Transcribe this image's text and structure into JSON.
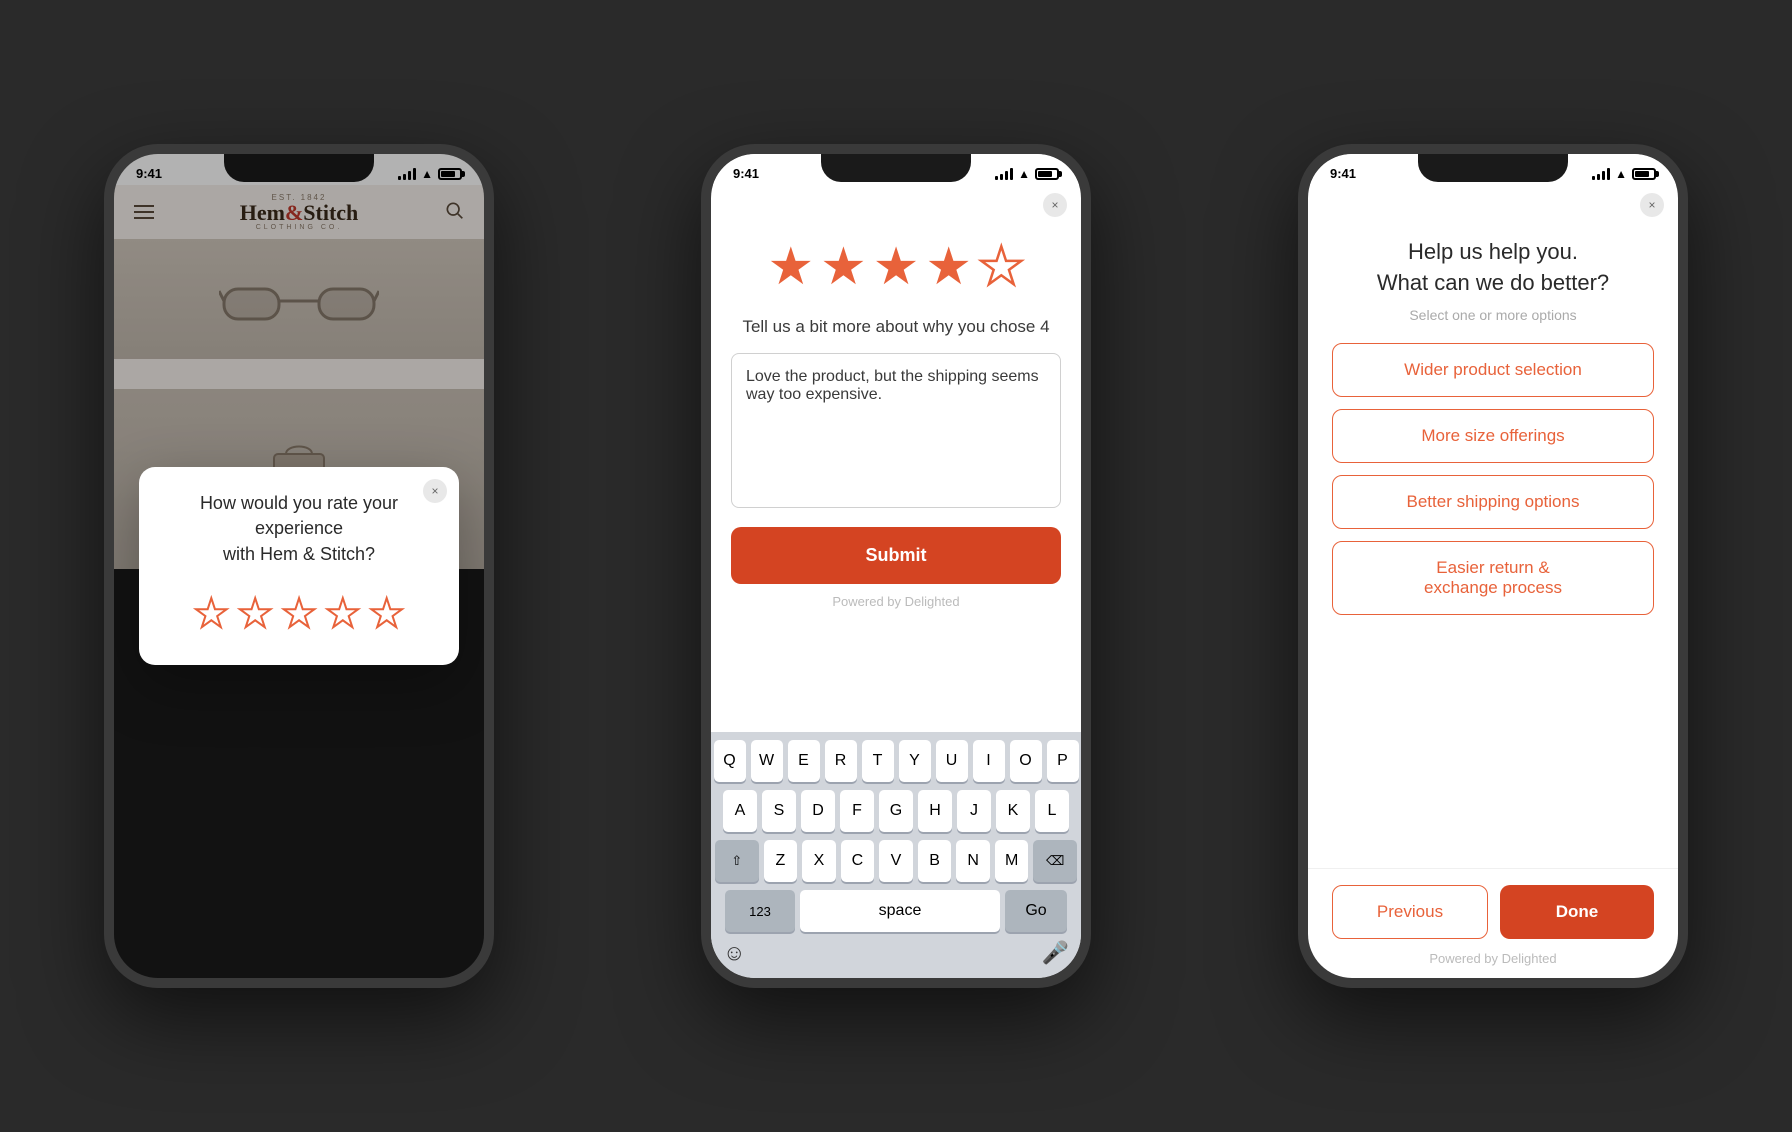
{
  "colors": {
    "accent": "#e8623a",
    "accent_dark": "#d44422",
    "bg_app": "#f5f0eb",
    "text_dark": "#2a2a2a",
    "text_muted": "#aaaaaa",
    "border": "#e8623a"
  },
  "phone1": {
    "status_time": "9:41",
    "logo_est": "EST. 1842",
    "logo_name": "Hem",
    "logo_ampersand": "&",
    "logo_name2": "Stitch",
    "logo_sub": "CLOTHING CO.",
    "modal": {
      "close_label": "×",
      "title_line1": "How would you rate your experience",
      "title_line2": "with Hem & Stitch?",
      "stars": [
        {
          "filled": false
        },
        {
          "filled": false
        },
        {
          "filled": false
        },
        {
          "filled": false
        },
        {
          "filled": false
        }
      ]
    }
  },
  "phone2": {
    "status_time": "9:41",
    "close_label": "×",
    "stars": [
      {
        "filled": true
      },
      {
        "filled": true
      },
      {
        "filled": true
      },
      {
        "filled": true
      },
      {
        "filled": false
      }
    ],
    "question": "Tell us a bit more about why you chose 4",
    "textarea_value": "Love the product, but the shipping seems way too expensive.",
    "submit_label": "Submit",
    "powered_by": "Powered by Delighted",
    "keyboard": {
      "row1": [
        "Q",
        "W",
        "E",
        "R",
        "T",
        "Y",
        "U",
        "I",
        "O",
        "P"
      ],
      "row2": [
        "A",
        "S",
        "D",
        "F",
        "G",
        "H",
        "J",
        "K",
        "L"
      ],
      "row3": [
        "Z",
        "X",
        "C",
        "V",
        "B",
        "N",
        "M"
      ],
      "row4_123": "123",
      "row4_space": "space",
      "row4_go": "Go"
    }
  },
  "phone3": {
    "status_time": "9:41",
    "close_label": "×",
    "title_line1": "Help us help you.",
    "title_line2": "What can we do better?",
    "subtitle": "Select one or more options",
    "options": [
      {
        "label": "Wider product selection"
      },
      {
        "label": "More size offerings"
      },
      {
        "label": "Better shipping options"
      },
      {
        "label": "Easier return &\nexchange process"
      }
    ],
    "option_labels": {
      "option1": "Wider product selection",
      "option2": "More size offerings",
      "option3": "Better shipping options",
      "option4": "Easier return & exchange process"
    },
    "prev_label": "Previous",
    "done_label": "Done",
    "powered_by": "Powered by Delighted"
  }
}
